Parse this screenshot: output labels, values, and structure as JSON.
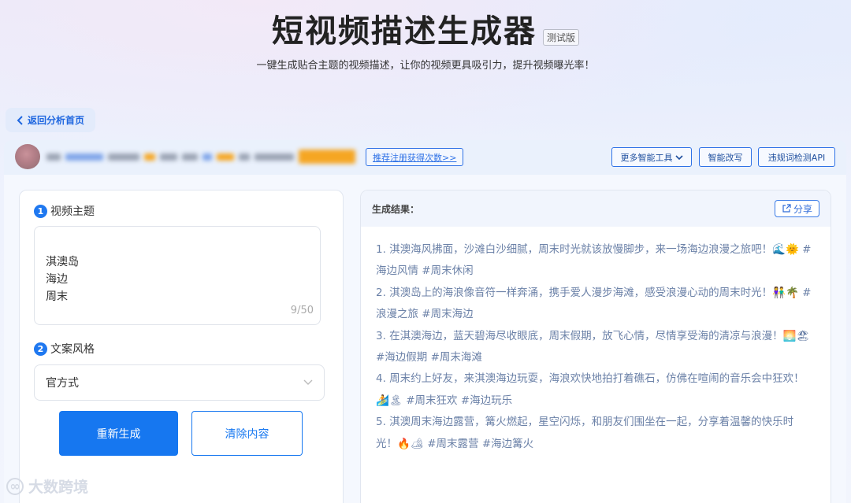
{
  "header": {
    "title": "短视频描述生成器",
    "badge": "测试版",
    "subtitle": "一键生成贴合主题的视频描述，让你的视频更具吸引力，提升视频曝光率！"
  },
  "nav": {
    "back_label": "返回分析首页",
    "back_icon": "chevron-left-icon"
  },
  "toolbar": {
    "register_link": "推荐注册获得次数>>",
    "more_tools": "更多智能工具",
    "rewrite": "智能改写",
    "api": "违规词检测API"
  },
  "form": {
    "step1_num": "1",
    "step1_label": "视频主题",
    "topic_value": "淇澳岛\n海边\n周末",
    "counter": "9/50",
    "step2_num": "2",
    "step2_label": "文案风格",
    "style_value": "官方式",
    "regenerate_label": "重新生成",
    "clear_label": "清除内容"
  },
  "result": {
    "title": "生成结果：",
    "share_label": "分享",
    "items": [
      "1. 淇澳海风拂面，沙滩白沙细腻，周末时光就该放慢脚步，来一场海边浪漫之旅吧！🌊🌞 #海边风情 #周末休闲",
      "2. 淇澳岛上的海浪像音符一样奔涌，携手爱人漫步海滩，感受浪漫心动的周末时光！👫🌴 #浪漫之旅 #周末海边",
      "3. 在淇澳海边，蓝天碧海尽收眼底，周末假期，放飞心情，尽情享受海的清凉与浪漫！🌅🏖 #海边假期 #周末海滩",
      "4. 周末约上好友，来淇澳海边玩耍，海浪欢快地拍打着礁石，仿佛在喧闹的音乐会中狂欢！🏄🏝 #周末狂欢 #海边玩乐",
      "5. 淇澳周末海边露营，篝火燃起，星空闪烁，和朋友们围坐在一起，分享着温馨的快乐时光！🔥🏕 #周末露营 #海边篝火"
    ]
  },
  "watermark": "大数跨境",
  "colors": {
    "primary": "#1677f0",
    "link": "#2f72e6",
    "result_text": "#6c82a8"
  }
}
